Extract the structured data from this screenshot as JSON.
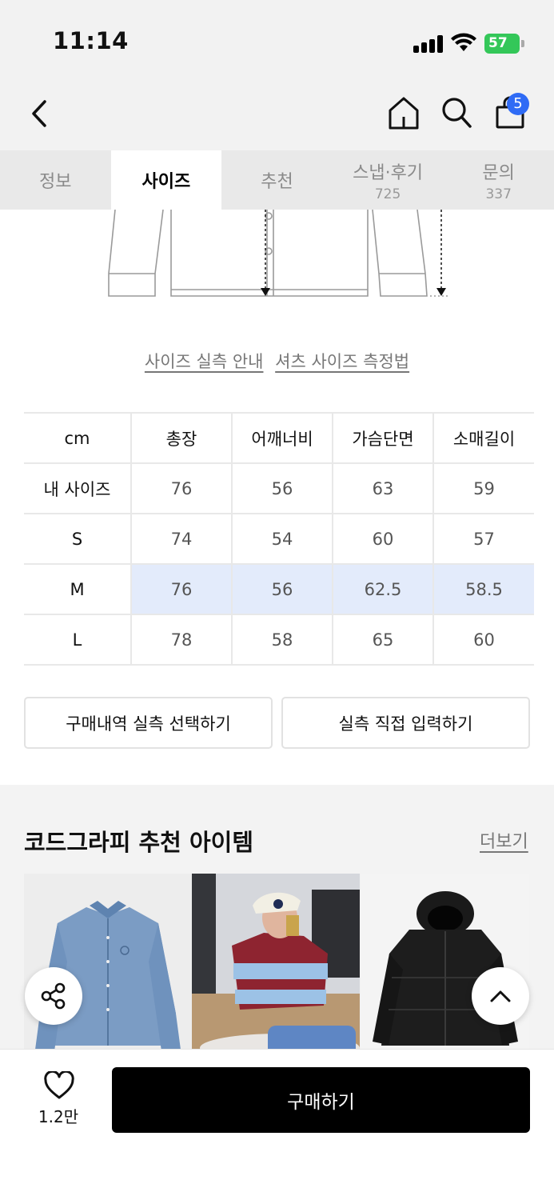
{
  "status": {
    "time": "11:14",
    "battery": "57"
  },
  "header": {
    "cart_count": "5"
  },
  "tabs": [
    {
      "label": "정보",
      "count": ""
    },
    {
      "label": "사이즈",
      "count": ""
    },
    {
      "label": "추천",
      "count": ""
    },
    {
      "label": "스냅·후기",
      "count": "725"
    },
    {
      "label": "문의",
      "count": "337"
    }
  ],
  "guides": {
    "measure_guide": "사이즈 실측 안내",
    "shirt_guide": "셔츠 사이즈 측정법"
  },
  "size_table": {
    "headers": [
      "cm",
      "총장",
      "어깨너비",
      "가슴단면",
      "소매길이"
    ],
    "rows": [
      [
        "내 사이즈",
        "76",
        "56",
        "63",
        "59"
      ],
      [
        "S",
        "74",
        "54",
        "60",
        "57"
      ],
      [
        "M",
        "76",
        "56",
        "62.5",
        "58.5"
      ],
      [
        "L",
        "78",
        "58",
        "65",
        "60"
      ]
    ]
  },
  "buttons": {
    "select_purchase": "구매내역 실측 선택하기",
    "manual_input": "실측 직접 입력하기"
  },
  "recommend": {
    "title": "코드그라피 추천 아이템",
    "more": "더보기"
  },
  "bottom": {
    "like_count": "1.2만",
    "buy_label": "구매하기"
  },
  "colors": {
    "accent": "#2f6bf5",
    "battery": "#34c759",
    "highlight_row": "#e3ebfb"
  }
}
